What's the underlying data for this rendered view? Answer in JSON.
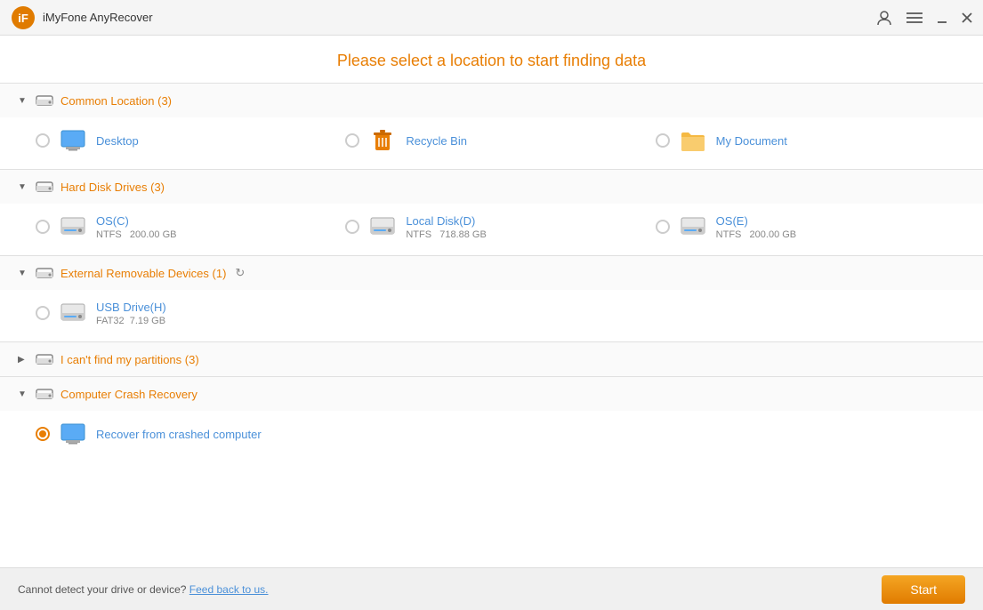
{
  "app": {
    "title": "iMyFone AnyRecover",
    "logo_text": "iF"
  },
  "header": {
    "prompt": "Please select a location to start finding data"
  },
  "sections": [
    {
      "id": "common-location",
      "title": "Common Location (3)",
      "expanded": true,
      "arrow": "▼",
      "items": [
        {
          "id": "desktop",
          "label": "Desktop",
          "selected": false
        },
        {
          "id": "recycle-bin",
          "label": "Recycle Bin",
          "selected": false
        },
        {
          "id": "my-document",
          "label": "My Document",
          "selected": false
        }
      ]
    },
    {
      "id": "hard-disk",
      "title": "Hard Disk Drives (3)",
      "expanded": true,
      "arrow": "▼",
      "disks": [
        {
          "id": "os-c",
          "name": "OS(C)",
          "fs": "NTFS",
          "size": "200.00 GB",
          "selected": false
        },
        {
          "id": "local-d",
          "name": "Local Disk(D)",
          "fs": "NTFS",
          "size": "718.88 GB",
          "selected": false
        },
        {
          "id": "os-e",
          "name": "OS(E)",
          "fs": "NTFS",
          "size": "200.00 GB",
          "selected": false
        }
      ]
    },
    {
      "id": "external-removable",
      "title": "External Removable Devices (1)",
      "expanded": true,
      "arrow": "▼",
      "has_refresh": true,
      "usb": [
        {
          "id": "usb-h",
          "name": "USB Drive(H)",
          "fs": "FAT32",
          "size": "7.19 GB",
          "selected": false
        }
      ]
    },
    {
      "id": "cant-find-partitions",
      "title": "I can't find my partitions (3)",
      "expanded": false,
      "arrow": "▶"
    },
    {
      "id": "computer-crash-recovery",
      "title": "Computer Crash Recovery",
      "expanded": true,
      "arrow": "▼",
      "crash_items": [
        {
          "id": "recover-crashed",
          "label": "Recover from crashed computer",
          "selected": true
        }
      ]
    }
  ],
  "bottom": {
    "text": "Cannot detect your drive or device?",
    "link_text": "Feed back to us.",
    "start_label": "Start"
  }
}
